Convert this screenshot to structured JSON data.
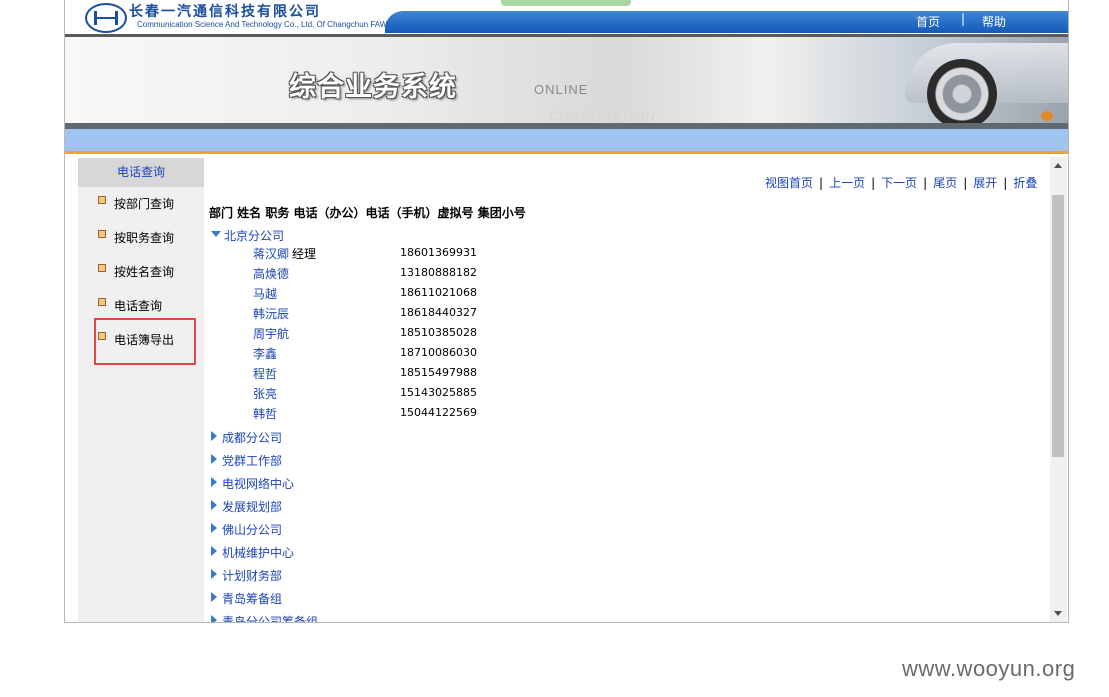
{
  "header": {
    "company_cn": "长春一汽通信科技有限公司",
    "company_en": "Communication Science And Technology Co., Ltd. Of Changchun FAW.",
    "nav": {
      "home": "首页",
      "sep": "|",
      "help": "帮助"
    }
  },
  "banner": {
    "title": "综合业务系统",
    "online": "ONLINE",
    "corporation": "CORPORATION"
  },
  "sidebar": {
    "title": "电话查询",
    "items": [
      {
        "label": "按部门查询"
      },
      {
        "label": "按职务查询"
      },
      {
        "label": "按姓名查询"
      },
      {
        "label": "电话查询"
      },
      {
        "label": "电话簿导出"
      }
    ]
  },
  "pager": {
    "first": "视图首页",
    "prev": "上一页",
    "next": "下一页",
    "last": "尾页",
    "expand": "展开",
    "collapse": "折叠",
    "sep": "|"
  },
  "table": {
    "header": "部门 姓名    职务 电话（办公）电话（手机）虚拟号 集团小号"
  },
  "tree": {
    "expanded": {
      "name": "北京分公司",
      "people": [
        {
          "name": "蒋汉卿",
          "title": "经理",
          "mobile": "18601369931"
        },
        {
          "name": "高焕德",
          "title": "",
          "mobile": "13180888182"
        },
        {
          "name": "马越",
          "title": "",
          "mobile": "18611021068"
        },
        {
          "name": "韩沅辰",
          "title": "",
          "mobile": "18618440327"
        },
        {
          "name": "周宇航",
          "title": "",
          "mobile": "18510385028"
        },
        {
          "name": "李鑫",
          "title": "",
          "mobile": "18710086030"
        },
        {
          "name": "程哲",
          "title": "",
          "mobile": "18515497988"
        },
        {
          "name": "张亮",
          "title": "",
          "mobile": "15143025885"
        },
        {
          "name": "韩哲",
          "title": "",
          "mobile": "15044122569"
        }
      ]
    },
    "collapsed": [
      {
        "name": "成都分公司"
      },
      {
        "name": "党群工作部"
      },
      {
        "name": "电视网络中心"
      },
      {
        "name": "发展规划部"
      },
      {
        "name": "佛山分公司"
      },
      {
        "name": "机械维护中心"
      },
      {
        "name": "计划财务部"
      },
      {
        "name": "青岛筹备组"
      },
      {
        "name": "青岛分公司筹备组"
      }
    ]
  },
  "watermark": "www.wooyun.org"
}
